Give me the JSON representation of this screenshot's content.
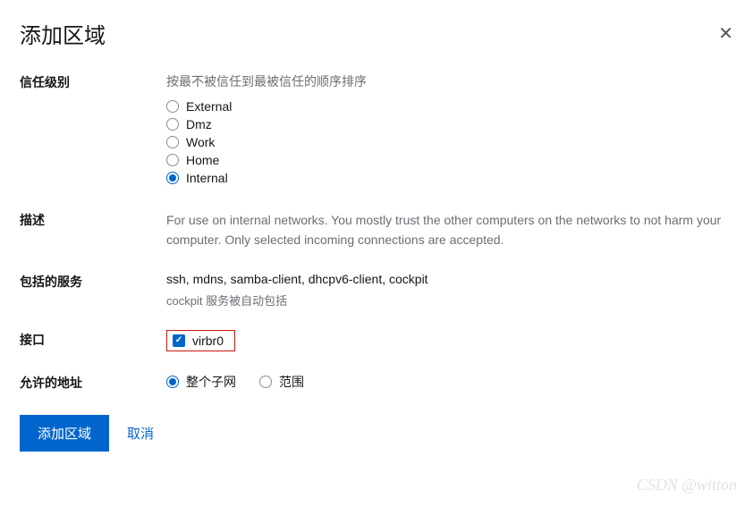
{
  "title": "添加区域",
  "labels": {
    "trust_level": "信任级别",
    "description": "描述",
    "services": "包括的服务",
    "interfaces": "接口",
    "allowed_addr": "允许的地址"
  },
  "trust": {
    "hint": "按最不被信任到最被信任的顺序排序",
    "options": [
      "External",
      "Dmz",
      "Work",
      "Home",
      "Internal"
    ],
    "selected": "Internal"
  },
  "description_text": "For use on internal networks. You mostly trust the other computers on the networks to not harm your computer. Only selected incoming connections are accepted.",
  "services_list": "ssh, mdns, samba-client, dhcpv6-client, cockpit",
  "services_note": "cockpit 服务被自动包括",
  "interfaces": {
    "items": [
      {
        "name": "virbr0",
        "checked": true
      }
    ]
  },
  "allowed": {
    "options": [
      "整个子网",
      "范围"
    ],
    "selected": "整个子网"
  },
  "footer": {
    "submit": "添加区域",
    "cancel": "取消"
  },
  "watermark": "CSDN @witton"
}
